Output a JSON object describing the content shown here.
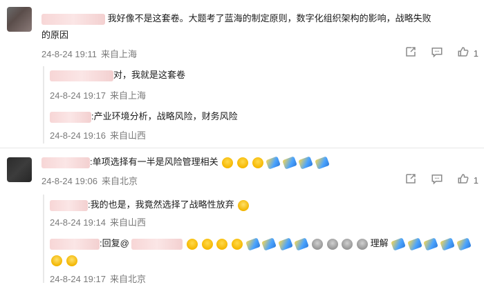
{
  "comments": [
    {
      "text": "我好像不是这套卷。大题考了蓝海的制定原则，数字化组织架构的影响，战略失败",
      "text_cont": "的原因",
      "meta": {
        "date": "24-8-24 19:11",
        "loc": "来自上海"
      },
      "actions": {
        "likes": "1"
      },
      "replies": [
        {
          "text": "对，我就是这套卷",
          "meta": {
            "date": "24-8-24 19:17",
            "loc": "来自上海"
          }
        },
        {
          "text": ":产业环境分析，战略风险，财务风险",
          "meta": {
            "date": "24-8-24 19:16",
            "loc": "来自山西"
          }
        }
      ]
    },
    {
      "text": ":单项选择有一半是风险管理相关",
      "meta": {
        "date": "24-8-24 19:06",
        "loc": "来自北京"
      },
      "actions": {
        "likes": "1"
      },
      "replies": [
        {
          "text": ":我的也是，我竟然选择了战略性放弃",
          "meta": {
            "date": "24-8-24 19:14",
            "loc": "来自山西"
          }
        },
        {
          "prefix": ":回复@",
          "text": "理解",
          "meta": {
            "date": "24-8-24 19:17",
            "loc": "来自北京"
          }
        }
      ]
    }
  ],
  "icons": {
    "share": "share-icon",
    "comment": "comment-icon",
    "like": "thumbs-up-icon"
  }
}
